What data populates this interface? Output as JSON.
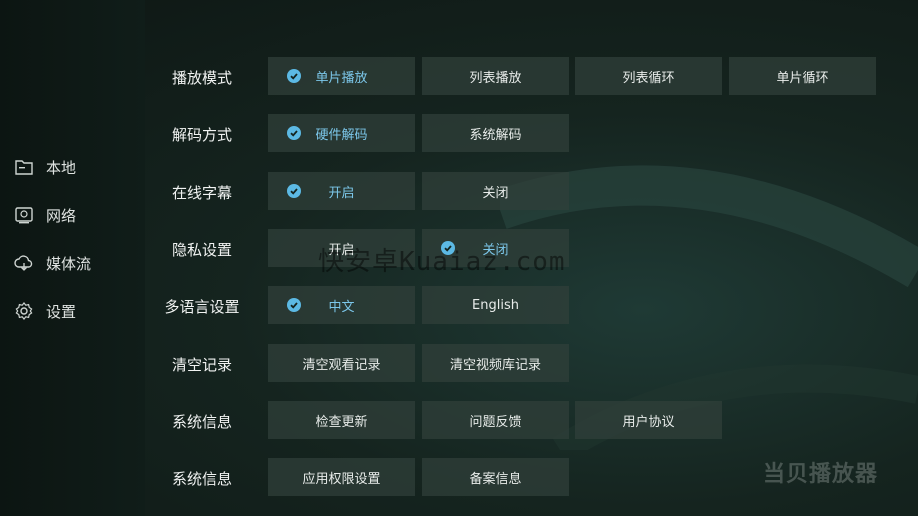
{
  "sidebar": {
    "items": [
      {
        "label": "本地",
        "icon": "folder-icon"
      },
      {
        "label": "网络",
        "icon": "network-drive-icon"
      },
      {
        "label": "媒体流",
        "icon": "cloud-icon"
      },
      {
        "label": "设置",
        "icon": "gear-icon"
      }
    ]
  },
  "settings": [
    {
      "label": "播放模式",
      "options": [
        {
          "text": "单片播放",
          "selected": true
        },
        {
          "text": "列表播放",
          "selected": false
        },
        {
          "text": "列表循环",
          "selected": false
        },
        {
          "text": "单片循环",
          "selected": false
        }
      ]
    },
    {
      "label": "解码方式",
      "options": [
        {
          "text": "硬件解码",
          "selected": true
        },
        {
          "text": "系统解码",
          "selected": false
        }
      ]
    },
    {
      "label": "在线字幕",
      "options": [
        {
          "text": "开启",
          "selected": true
        },
        {
          "text": "关闭",
          "selected": false
        }
      ]
    },
    {
      "label": "隐私设置",
      "options": [
        {
          "text": "开启",
          "selected": false
        },
        {
          "text": "关闭",
          "selected": true
        }
      ]
    },
    {
      "label": "多语言设置",
      "options": [
        {
          "text": "中文",
          "selected": true
        },
        {
          "text": "English",
          "selected": false
        }
      ]
    },
    {
      "label": "清空记录",
      "options": [
        {
          "text": "清空观看记录",
          "selected": false
        },
        {
          "text": "清空视频库记录",
          "selected": false
        }
      ]
    },
    {
      "label": "系统信息",
      "options": [
        {
          "text": "检查更新",
          "selected": false
        },
        {
          "text": "问题反馈",
          "selected": false
        },
        {
          "text": "用户协议",
          "selected": false
        }
      ]
    },
    {
      "label": "系统信息",
      "options": [
        {
          "text": "应用权限设置",
          "selected": false
        },
        {
          "text": "备案信息",
          "selected": false
        }
      ]
    }
  ],
  "watermark": "快安卓Kuaiaz.com",
  "brand": "当贝播放器",
  "colors": {
    "accent": "#5cb9e4",
    "selected_text": "#7cc7ea",
    "option_bg": "#30403a"
  }
}
